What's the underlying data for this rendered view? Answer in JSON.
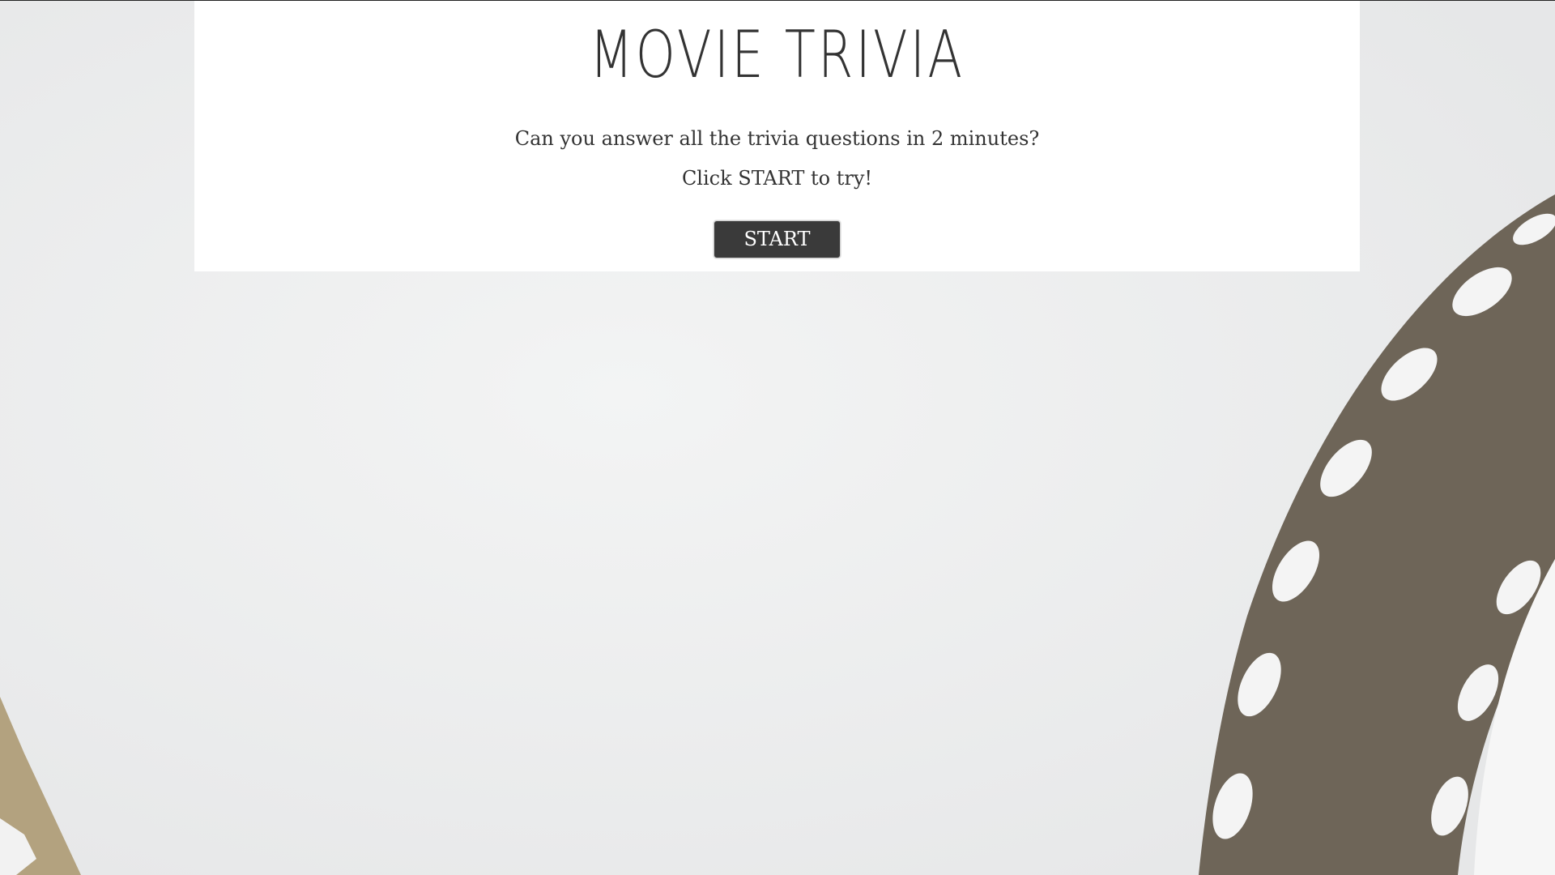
{
  "page": {
    "title": "MOVIE TRIVIA",
    "intro_question": "Can you answer all the trivia questions in 2 minutes?",
    "intro_instruction": "Click START to try!",
    "start_button_label": "START"
  },
  "colors": {
    "panel_background": "#ffffff",
    "text": "#333333",
    "button_background": "#3a3a3a",
    "button_text": "#ffffff",
    "film_strip": "#6e6558",
    "film_strip_left": "#b3a27f",
    "page_background": "#ecedee"
  },
  "background": {
    "image_name": "film-reel-background"
  }
}
